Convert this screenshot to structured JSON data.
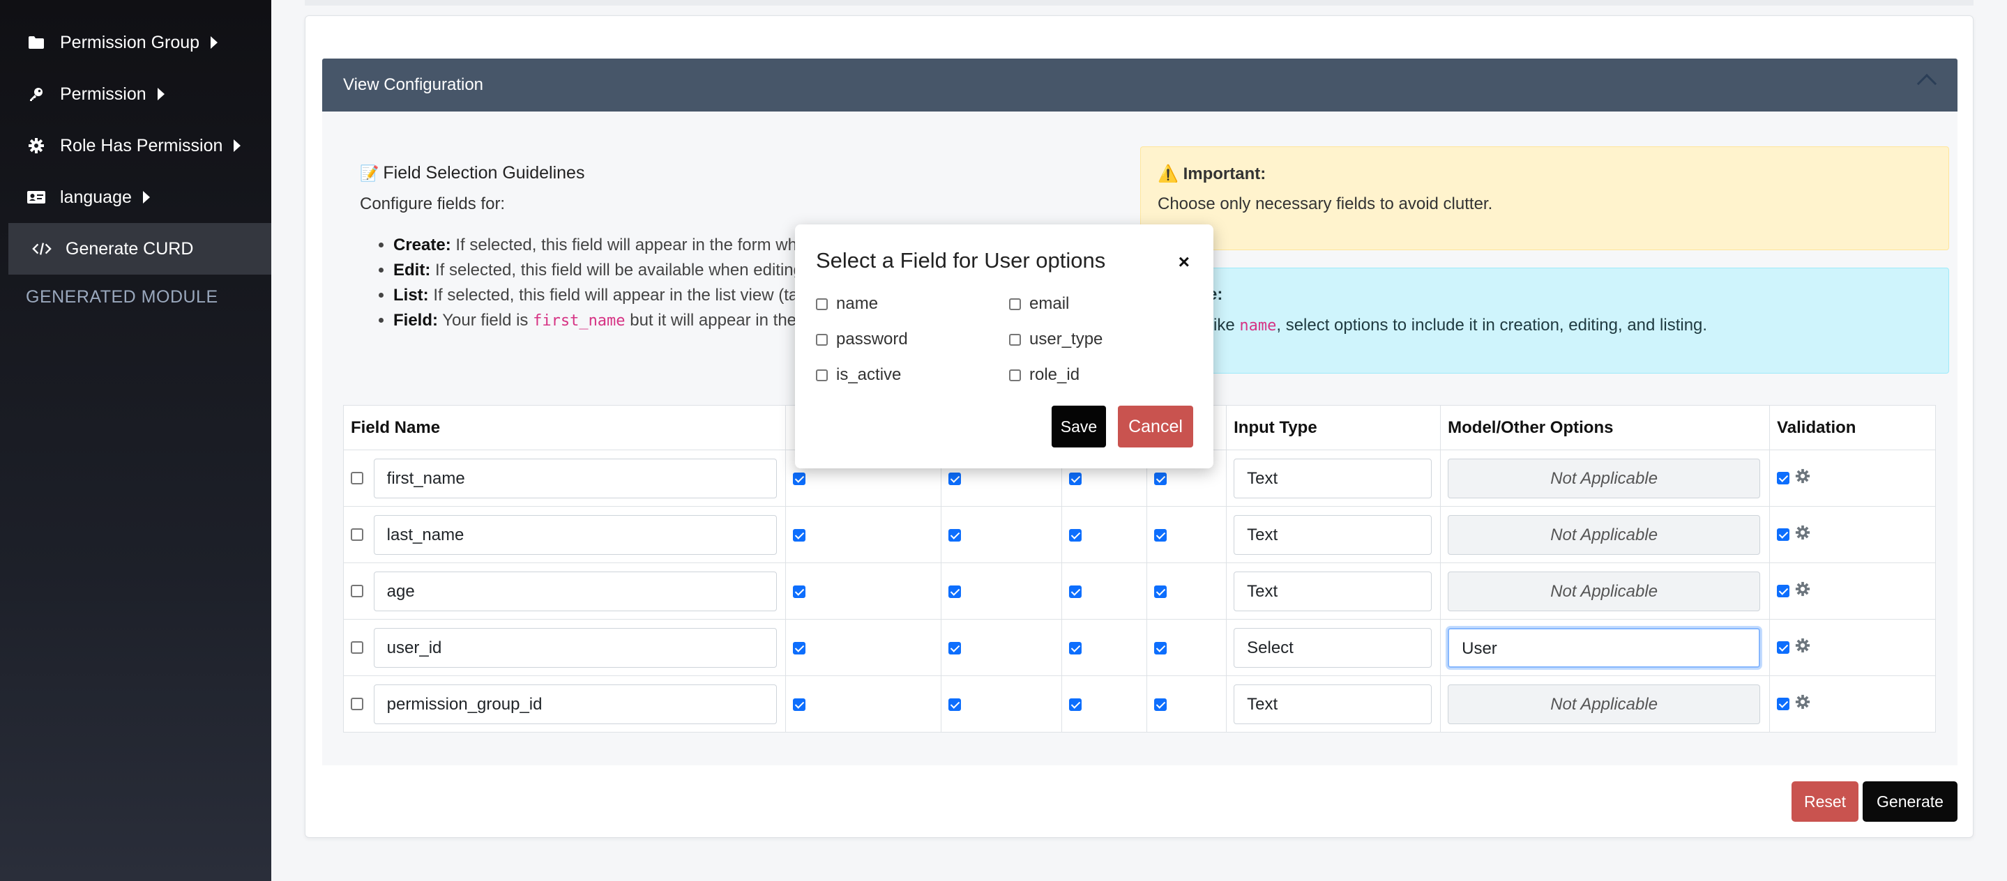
{
  "sidebar": {
    "items": [
      {
        "label": "Permission Group",
        "icon": "folder-icon"
      },
      {
        "label": "Permission",
        "icon": "key-icon"
      },
      {
        "label": "Role Has Permission",
        "icon": "gear-icon"
      },
      {
        "label": "language",
        "icon": "id-card-icon"
      },
      {
        "label": "Generate CURD",
        "icon": "code-icon"
      }
    ],
    "section_label": "GENERATED MODULE"
  },
  "panel": {
    "title": "View Configuration"
  },
  "guidelines": {
    "title": "Field Selection Guidelines",
    "subtitle": "Configure fields for:",
    "items": [
      {
        "term": "Create:",
        "text": " If selected, this field will appear in the form whe"
      },
      {
        "term": "Edit:",
        "text": " If selected, this field will be available when editing"
      },
      {
        "term": "List:",
        "text": " If selected, this field will appear in the list view (tab"
      },
      {
        "term": "Field:",
        "text_before": " Your field is ",
        "code": "first_name",
        "text_after": " but it will appear in the f"
      }
    ]
  },
  "important": {
    "title": "Important:",
    "text": "Choose only necessary fields to avoid clutter."
  },
  "example": {
    "title": "nple:",
    "text_before": "eld like ",
    "code": "name",
    "text_after": ", select options to include it in creation, editing, and listing."
  },
  "table": {
    "headers": [
      "Field Name",
      "",
      "",
      "",
      "",
      "Input Type",
      "Model/Other Options",
      "Validation"
    ],
    "rows": [
      {
        "field": "first_name",
        "input_type": "Text",
        "options": "Not Applicable"
      },
      {
        "field": "last_name",
        "input_type": "Text",
        "options": "Not Applicable"
      },
      {
        "field": "age",
        "input_type": "Text",
        "options": "Not Applicable"
      },
      {
        "field": "user_id",
        "input_type": "Select",
        "options": "User"
      },
      {
        "field": "permission_group_id",
        "input_type": "Text",
        "options": "Not Applicable"
      }
    ]
  },
  "footer": {
    "reset_label": "Reset",
    "generate_label": "Generate"
  },
  "modal": {
    "title": "Select a Field for User options",
    "close_label": "×",
    "options": [
      "name",
      "email",
      "password",
      "user_type",
      "is_active",
      "role_id"
    ],
    "save_label": "Save",
    "cancel_label": "Cancel"
  },
  "colors": {
    "accent_blue": "#0d6efd",
    "danger": "#c9534f",
    "panel_header": "#475669"
  }
}
